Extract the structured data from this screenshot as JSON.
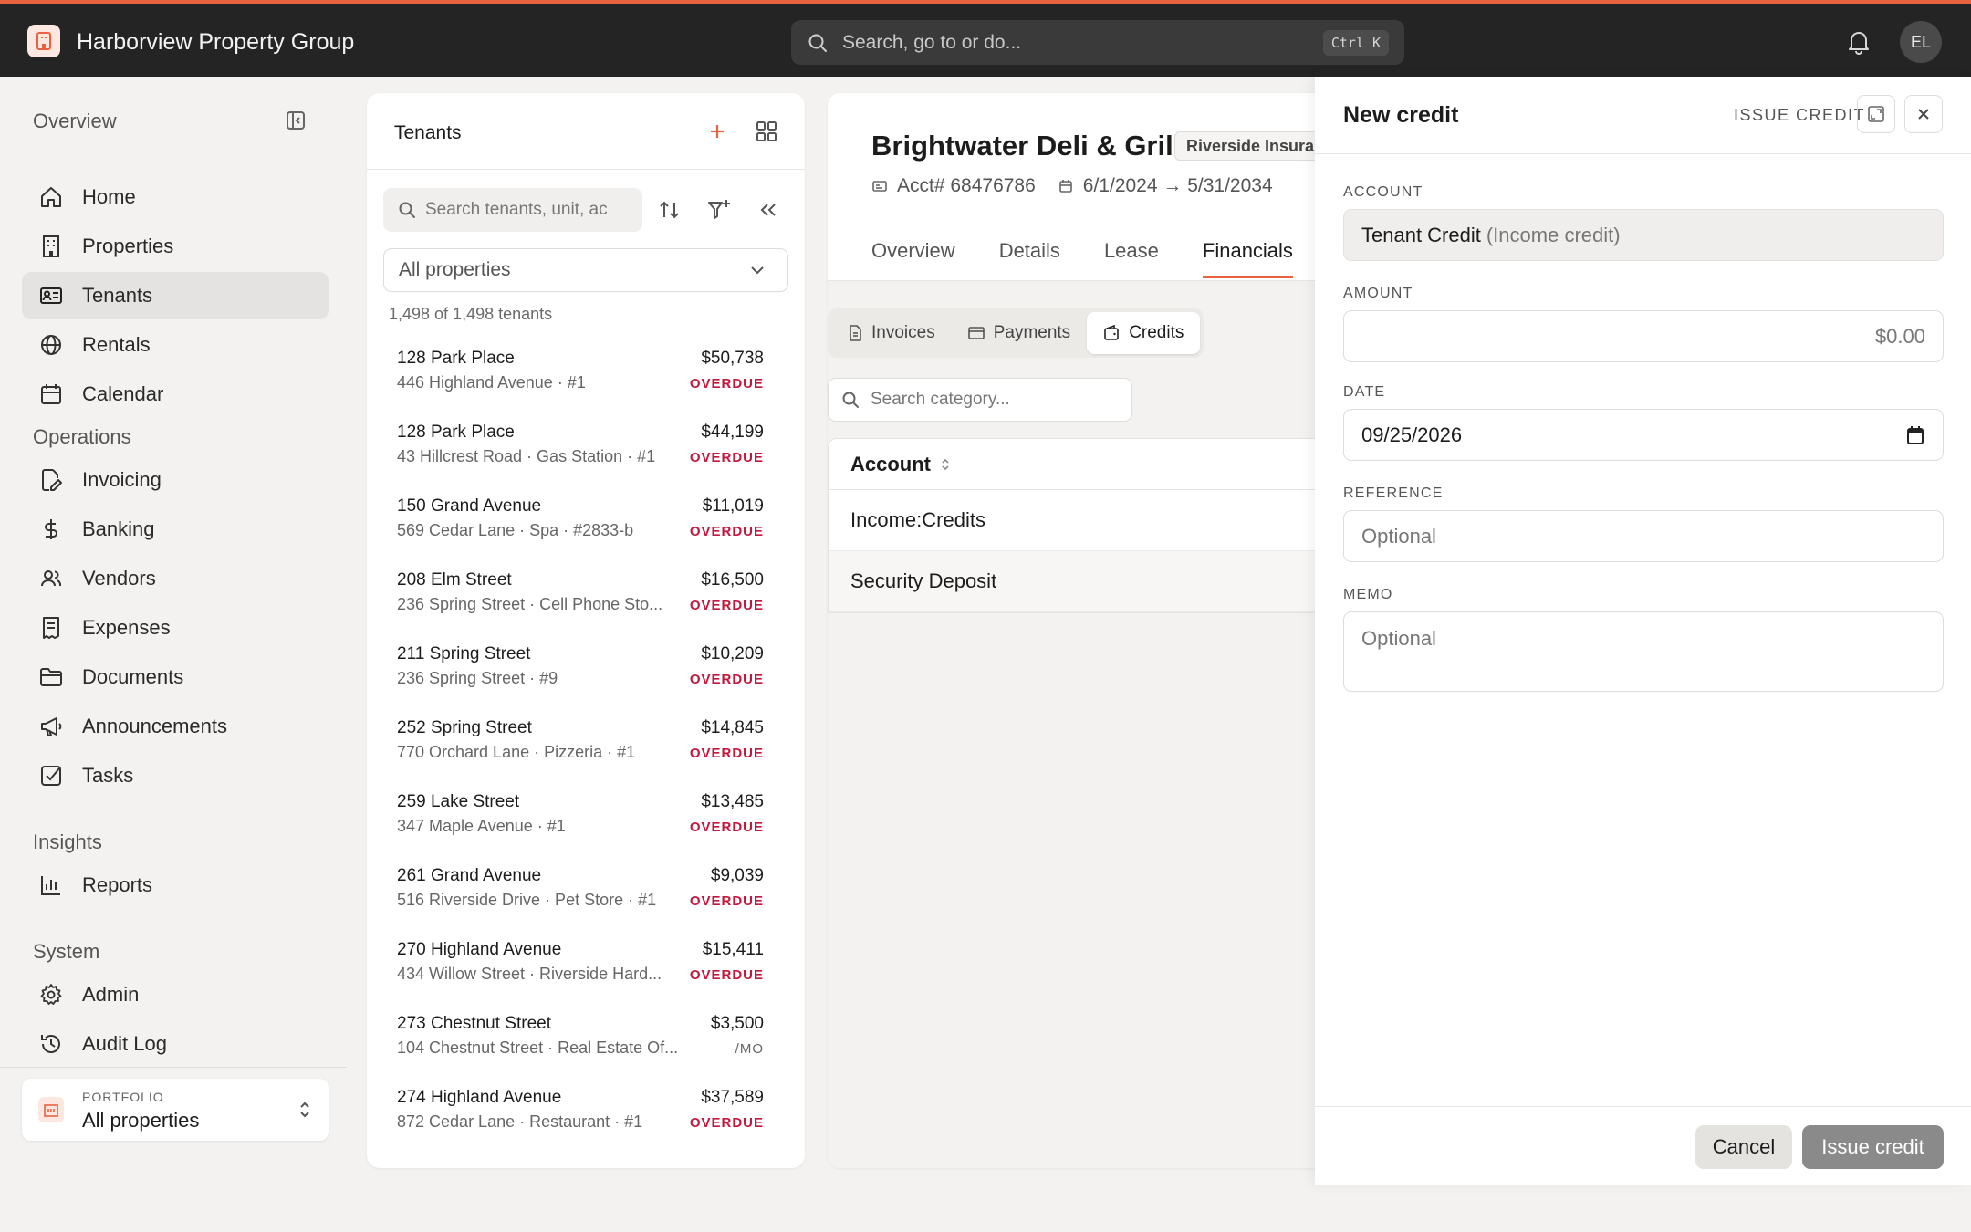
{
  "app": {
    "title": "Harborview Property Group",
    "search_placeholder": "Search, go to or do...",
    "shortcut": "Ctrl K",
    "avatar_initials": "EL",
    "accent_color": "#e8623f"
  },
  "sidebar": {
    "overview_heading": "Overview",
    "overview_items": [
      {
        "label": "Home",
        "icon": "home-icon"
      },
      {
        "label": "Properties",
        "icon": "building-icon"
      },
      {
        "label": "Tenants",
        "icon": "id-card-icon",
        "active": true
      },
      {
        "label": "Rentals",
        "icon": "globe-icon"
      },
      {
        "label": "Calendar",
        "icon": "calendar-icon"
      }
    ],
    "operations_heading": "Operations",
    "operations_items": [
      {
        "label": "Invoicing",
        "icon": "file-edit-icon"
      },
      {
        "label": "Banking",
        "icon": "dollar-icon"
      },
      {
        "label": "Vendors",
        "icon": "users-icon"
      },
      {
        "label": "Expenses",
        "icon": "receipt-icon"
      },
      {
        "label": "Documents",
        "icon": "folder-icon"
      },
      {
        "label": "Announcements",
        "icon": "megaphone-icon"
      },
      {
        "label": "Tasks",
        "icon": "checkbox-icon"
      }
    ],
    "insights_heading": "Insights",
    "insights_items": [
      {
        "label": "Reports",
        "icon": "bar-chart-icon"
      }
    ],
    "system_heading": "System",
    "system_items": [
      {
        "label": "Admin",
        "icon": "gear-icon"
      },
      {
        "label": "Audit Log",
        "icon": "history-icon"
      }
    ],
    "portfolio_label": "PORTFOLIO",
    "portfolio_value": "All properties"
  },
  "tenants": {
    "title": "Tenants",
    "search_placeholder": "Search tenants, unit, ac",
    "property_filter": "All properties",
    "count_text": "1,498 of 1,498 tenants",
    "rows": [
      {
        "name": "128 Park Place",
        "address": "446 Highland Avenue · #1",
        "amount": "$50,738",
        "status": "OVERDUE"
      },
      {
        "name": "128 Park Place",
        "address": "43 Hillcrest Road · Gas Station · #1",
        "amount": "$44,199",
        "status": "OVERDUE"
      },
      {
        "name": "150 Grand Avenue",
        "address": "569 Cedar Lane · Spa · #2833-b",
        "amount": "$11,019",
        "status": "OVERDUE"
      },
      {
        "name": "208 Elm Street",
        "address": "236 Spring Street · Cell Phone Sto...",
        "amount": "$16,500",
        "status": "OVERDUE"
      },
      {
        "name": "211 Spring Street",
        "address": "236 Spring Street · #9",
        "amount": "$10,209",
        "status": "OVERDUE"
      },
      {
        "name": "252 Spring Street",
        "address": "770 Orchard Lane · Pizzeria · #1",
        "amount": "$14,845",
        "status": "OVERDUE"
      },
      {
        "name": "259 Lake Street",
        "address": "347 Maple Avenue · #1",
        "amount": "$13,485",
        "status": "OVERDUE"
      },
      {
        "name": "261 Grand Avenue",
        "address": "516 Riverside Drive · Pet Store · #1",
        "amount": "$9,039",
        "status": "OVERDUE"
      },
      {
        "name": "270 Highland Avenue",
        "address": "434 Willow Street · Riverside Hard...",
        "amount": "$15,411",
        "status": "OVERDUE"
      },
      {
        "name": "273 Chestnut Street",
        "address": "104 Chestnut Street · Real Estate Of...",
        "amount": "$3,500",
        "status": "/MO"
      },
      {
        "name": "274 Highland Avenue",
        "address": "872 Cedar Lane · Restaurant · #1",
        "amount": "$37,589",
        "status": "OVERDUE"
      }
    ]
  },
  "detail": {
    "title": "Brightwater Deli & Grill",
    "badge": "Riverside Insura",
    "account_number": "Acct# 68476786",
    "lease_dates": "6/1/2024 → 5/31/2034",
    "tabs": [
      "Overview",
      "Details",
      "Lease",
      "Financials"
    ],
    "active_tab": "Financials",
    "segments": [
      {
        "label": "Invoices",
        "icon": "document-icon"
      },
      {
        "label": "Payments",
        "icon": "credit-card-icon"
      },
      {
        "label": "Credits",
        "icon": "wallet-icon",
        "active": true
      }
    ],
    "category_search_placeholder": "Search category...",
    "table_header": "Account",
    "table_rows": [
      "Income:Credits",
      "Security Deposit"
    ]
  },
  "drawer": {
    "title": "New credit",
    "issue_label": "ISSUE CREDIT",
    "account_label": "ACCOUNT",
    "account_value": "Tenant Credit",
    "account_sub": "(Income credit)",
    "amount_label": "AMOUNT",
    "amount_placeholder": "$0.00",
    "date_label": "DATE",
    "date_value": "09/25/2026",
    "reference_label": "REFERENCE",
    "reference_placeholder": "Optional",
    "memo_label": "MEMO",
    "memo_placeholder": "Optional",
    "cancel_label": "Cancel",
    "submit_label": "Issue credit"
  }
}
